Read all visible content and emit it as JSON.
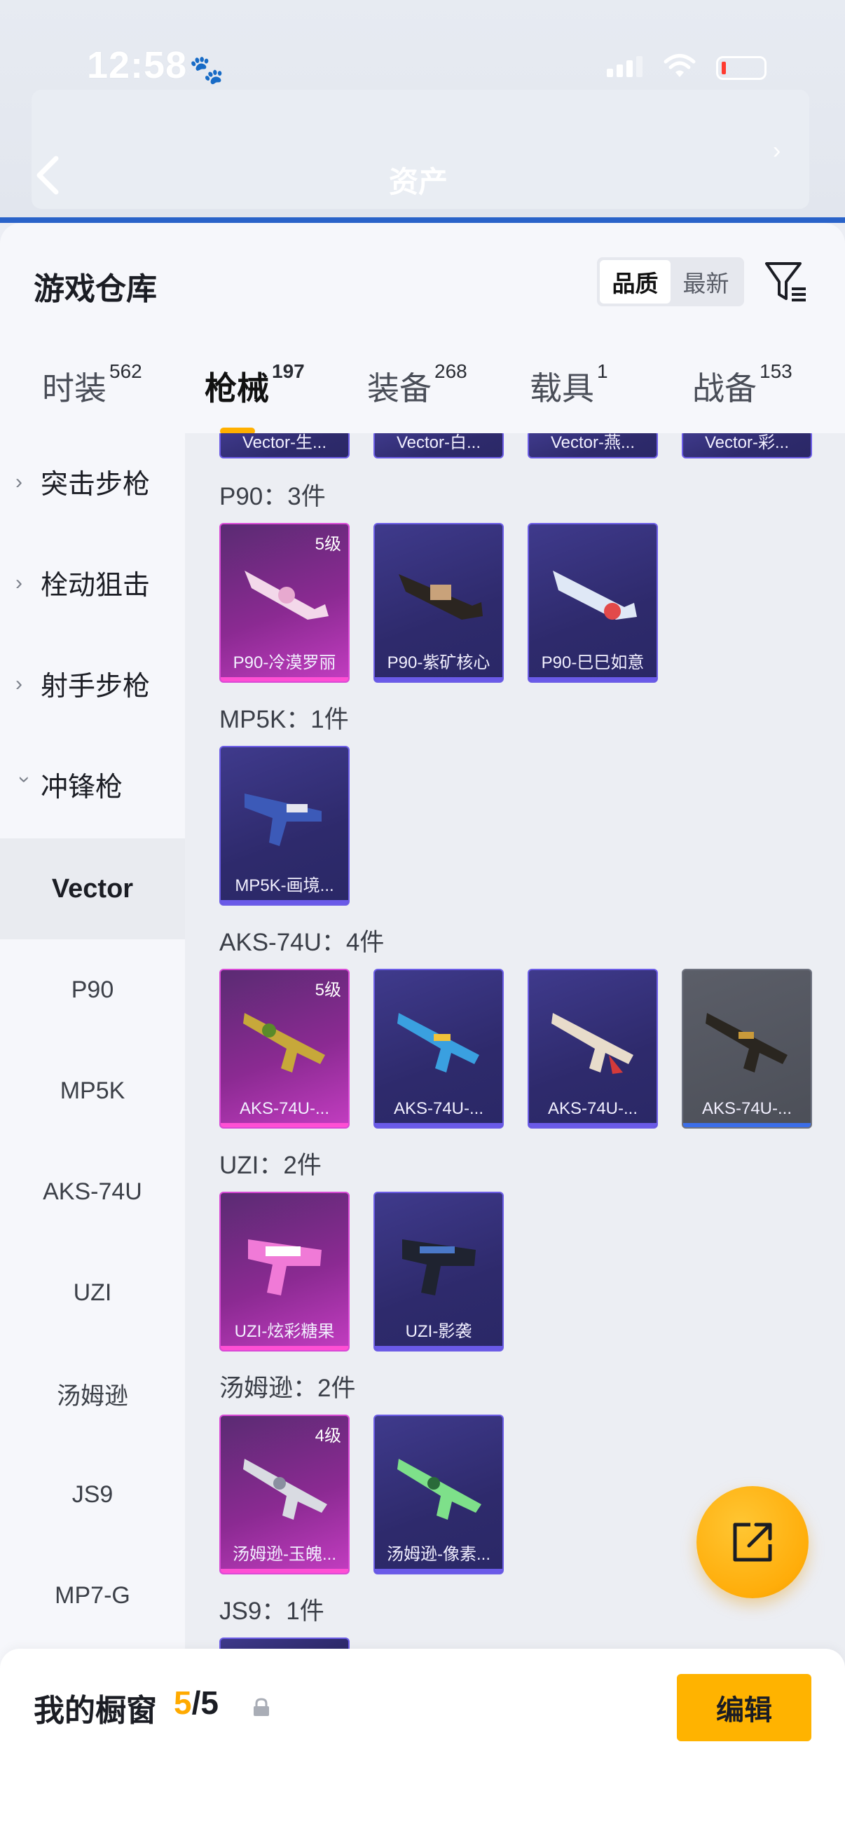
{
  "status": {
    "time": "12:58"
  },
  "header": {
    "title": "资产"
  },
  "sheet": {
    "title": "游戏仓库"
  },
  "sort": {
    "quality": "品质",
    "newest": "最新"
  },
  "tabs": [
    {
      "label": "时装",
      "count": "562"
    },
    {
      "label": "枪械",
      "count": "197"
    },
    {
      "label": "装备",
      "count": "268"
    },
    {
      "label": "载具",
      "count": "1"
    },
    {
      "label": "战备",
      "count": "153"
    }
  ],
  "sidebar": {
    "categories": [
      "突击步枪",
      "栓动狙击",
      "射手步枪",
      "冲锋枪"
    ],
    "subs": [
      "Vector",
      "P90",
      "MP5K",
      "AKS-74U",
      "UZI",
      "汤姆逊",
      "JS9",
      "MP7-G"
    ]
  },
  "groups": {
    "vector_partial": [
      "Vector-生...",
      "Vector-白...",
      "Vector-燕...",
      "Vector-彩..."
    ],
    "p90": {
      "title": "P90：3件",
      "items": [
        "P90-冷漠罗丽",
        "P90-紫矿核心",
        "P90-巳巳如意"
      ],
      "level0": "5级"
    },
    "mp5k": {
      "title": "MP5K：1件",
      "items": [
        "MP5K-画境..."
      ]
    },
    "aks": {
      "title": "AKS-74U：4件",
      "items": [
        "AKS-74U-...",
        "AKS-74U-...",
        "AKS-74U-...",
        "AKS-74U-..."
      ],
      "level0": "5级"
    },
    "uzi": {
      "title": "UZI：2件",
      "items": [
        "UZI-炫彩糖果",
        "UZI-影袭"
      ]
    },
    "thompson": {
      "title": "汤姆逊：2件",
      "items": [
        "汤姆逊-玉魄...",
        "汤姆逊-像素..."
      ],
      "level0": "4级"
    },
    "js9": {
      "title": "JS9：1件"
    }
  },
  "showcase": {
    "label": "我的橱窗",
    "current": "5",
    "total": "/5",
    "edit": "编辑"
  },
  "colors": {
    "accent": "#ffb300",
    "card_purple": "#2e2a6c",
    "card_pink": "#8b2a92"
  }
}
